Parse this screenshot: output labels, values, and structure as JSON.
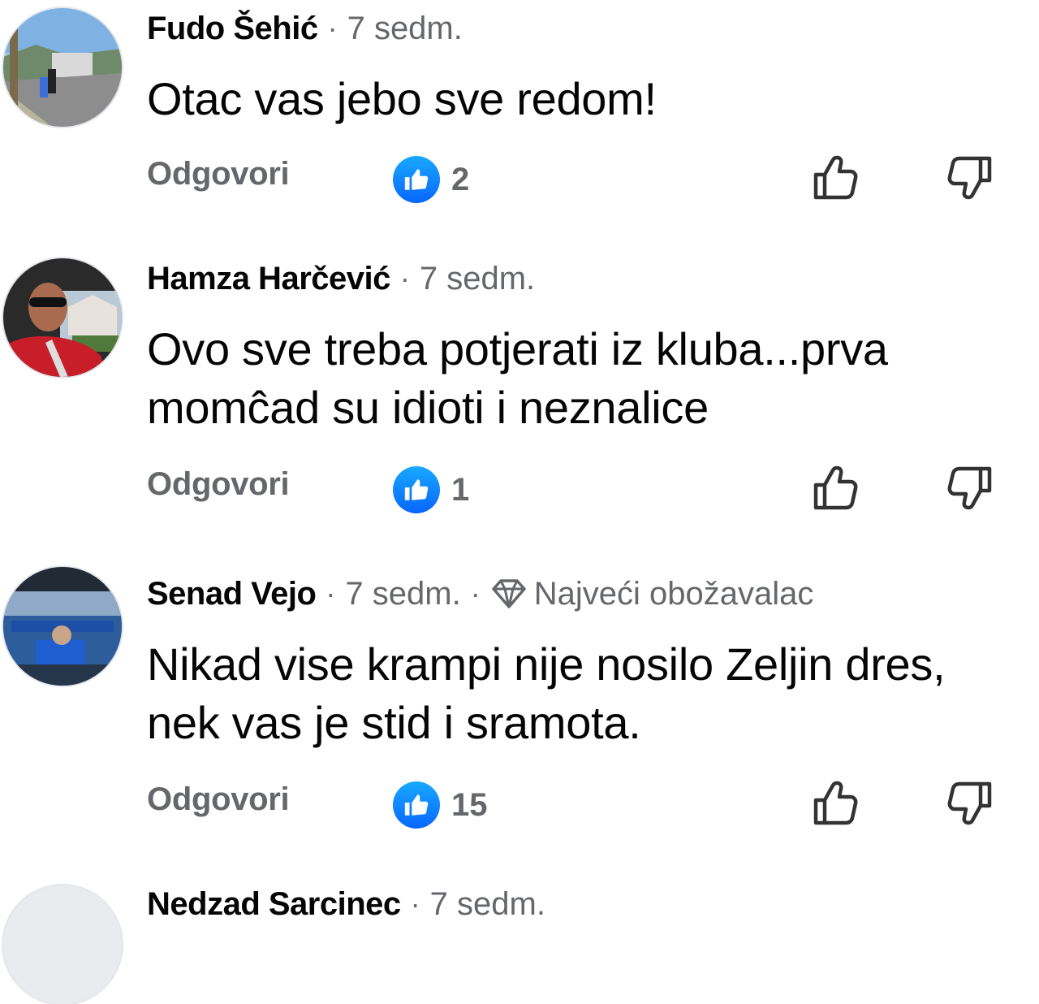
{
  "comments": [
    {
      "author": "Fudo Šehić",
      "separator": "·",
      "time": "7 sedm.",
      "badge": "",
      "text": "Otac vas jebo sve redom!",
      "reply_label": "Odgovori",
      "reaction_count": "2"
    },
    {
      "author": "Hamza Harčević",
      "separator": "·",
      "time": "7 sedm.",
      "badge": "",
      "text": "Ovo sve treba potjerati iz kluba...prva momĉad su idioti i neznalice",
      "reply_label": "Odgovori",
      "reaction_count": "1"
    },
    {
      "author": "Senad Vejo",
      "separator": "·",
      "time": "7 sedm.",
      "separator2": "·",
      "badge": "Najveći obožavalac",
      "text": "Nikad vise krampi nije nosilo Zeljin dres, nek vas je stid i sramota.",
      "reply_label": "Odgovori",
      "reaction_count": "15"
    },
    {
      "author": "Nedzad Sarcinec",
      "separator": "·",
      "time": "7 sedm."
    }
  ],
  "colors": {
    "text_primary": "#050505",
    "text_secondary": "#65676b",
    "like_blue": "#0866ff"
  },
  "icons": {
    "like_badge": "thumbs-up-icon",
    "like_button": "thumbs-up-outline-icon",
    "dislike_button": "thumbs-down-outline-icon",
    "badge": "diamond-icon"
  }
}
